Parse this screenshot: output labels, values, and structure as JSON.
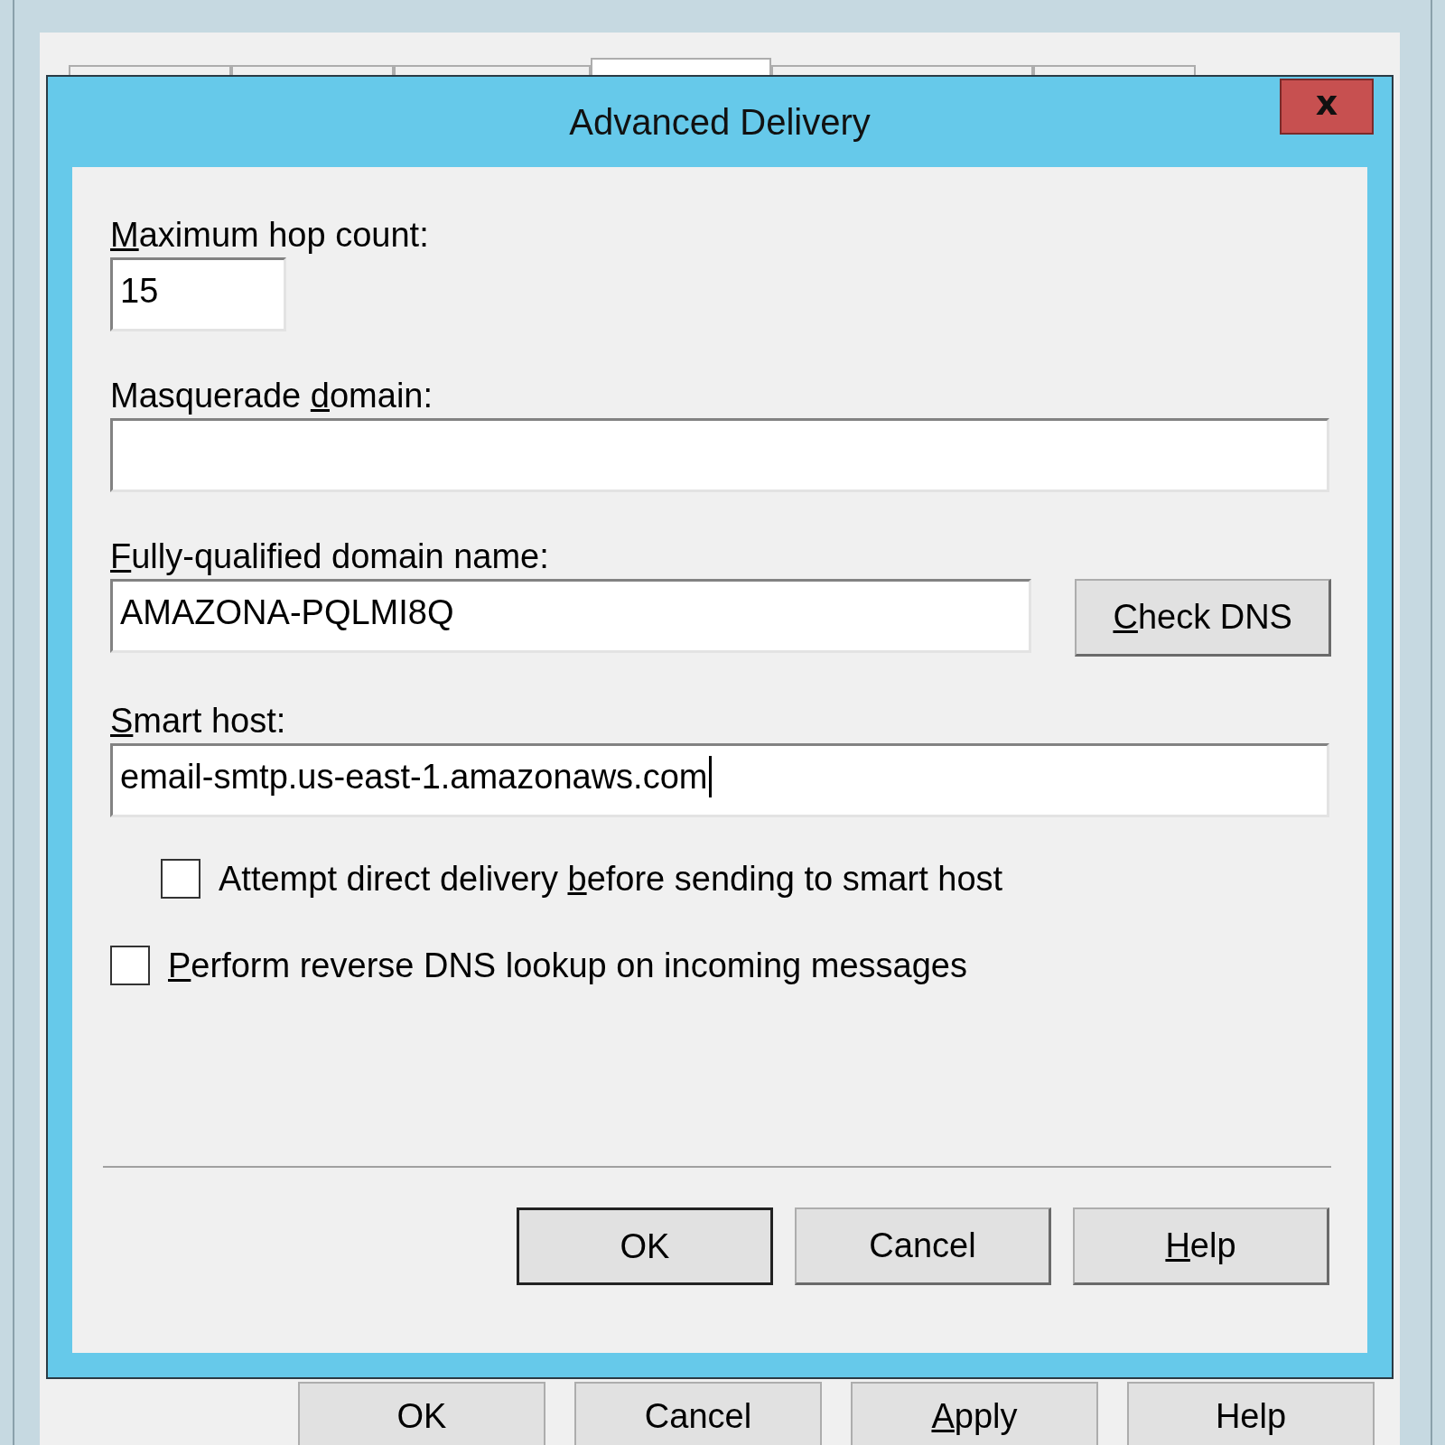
{
  "parent_window": {
    "tabs": [
      {
        "selected": false
      },
      {
        "selected": false
      },
      {
        "selected": false
      },
      {
        "selected": true
      },
      {
        "selected": false
      },
      {
        "selected": false
      }
    ],
    "buttons": [
      {
        "post": "OK",
        "default": false
      },
      {
        "post": "Cancel",
        "default": false
      },
      {
        "key": "A",
        "post": "pply",
        "default": false
      },
      {
        "post": "Help",
        "default": false
      }
    ]
  },
  "dialog": {
    "title": "Advanced Delivery",
    "close": "x",
    "fields": [
      {
        "kind": "number",
        "label": {
          "key": "M",
          "post": "aximum hop count:"
        },
        "value": "15",
        "focused": false
      },
      {
        "kind": "text",
        "label": {
          "pre": "Masquerade ",
          "key": "d",
          "post": "omain:"
        },
        "focused": false
      },
      {
        "kind": "text",
        "label": {
          "key": "F",
          "post": "ully-qualified domain name:"
        },
        "value": "AMAZONA-PQLMI8Q",
        "focused": false,
        "button": {
          "key": "C",
          "post": "heck DNS"
        }
      },
      {
        "kind": "text",
        "label": {
          "key": "S",
          "post": "mart host:"
        },
        "value": "email-smtp.us-east-1.amazonaws.com",
        "focused": true
      }
    ],
    "checkboxes": [
      {
        "label": {
          "pre": "Attempt direct delivery ",
          "key": "b",
          "post": "efore sending to smart host"
        },
        "checked": false,
        "indented": true
      },
      {
        "label": {
          "key": "P",
          "post": "erform reverse DNS lookup on incoming messages"
        },
        "checked": false,
        "indented": false
      }
    ],
    "buttons": [
      {
        "post": "OK",
        "default": true
      },
      {
        "post": "Cancel",
        "default": false
      },
      {
        "key": "H",
        "post": "elp",
        "default": false
      }
    ]
  }
}
